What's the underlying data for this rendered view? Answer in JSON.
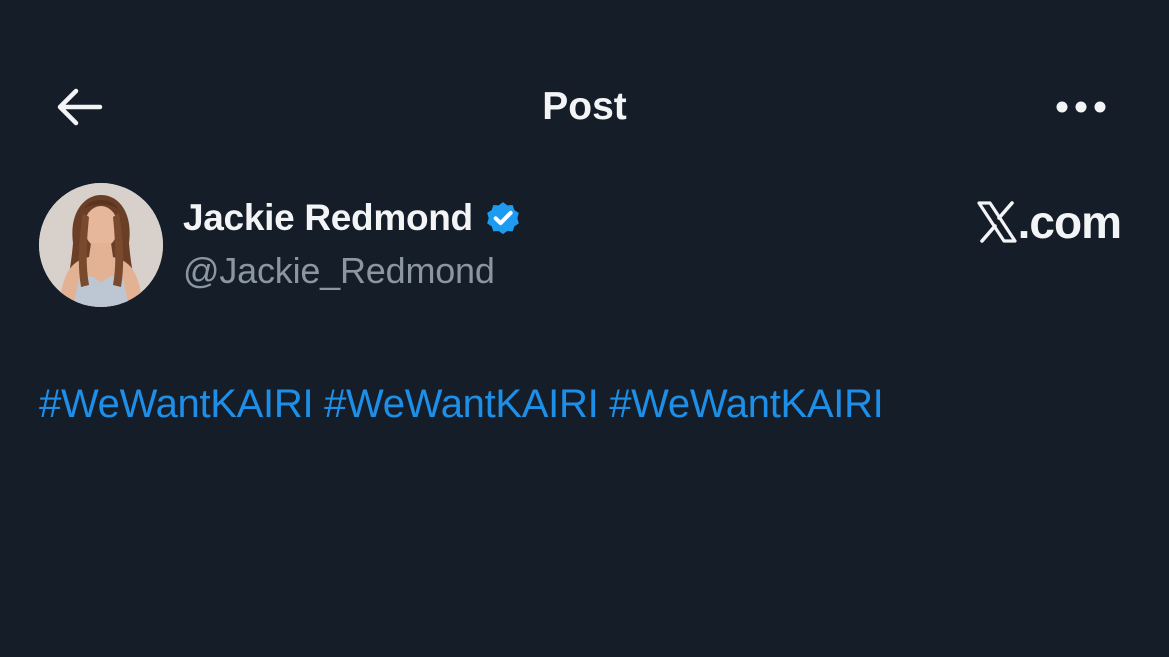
{
  "header": {
    "title": "Post",
    "back_icon": "arrow-left-icon",
    "more_icon": "more-horizontal-icon"
  },
  "author": {
    "display_name": "Jackie Redmond",
    "handle": "@Jackie_Redmond",
    "verified": true,
    "verified_icon": "verified-badge-icon"
  },
  "watermark": {
    "logo": "x-logo-icon",
    "suffix": ".com"
  },
  "post": {
    "hashtags": [
      "#WeWantKAIRI",
      "#WeWantKAIRI",
      "#WeWantKAIRI"
    ]
  },
  "colors": {
    "background": "#151d28",
    "text_primary": "#f3f4f6",
    "text_secondary": "#8b96a3",
    "link": "#1d8fe8",
    "verified": "#1d9bf0"
  }
}
